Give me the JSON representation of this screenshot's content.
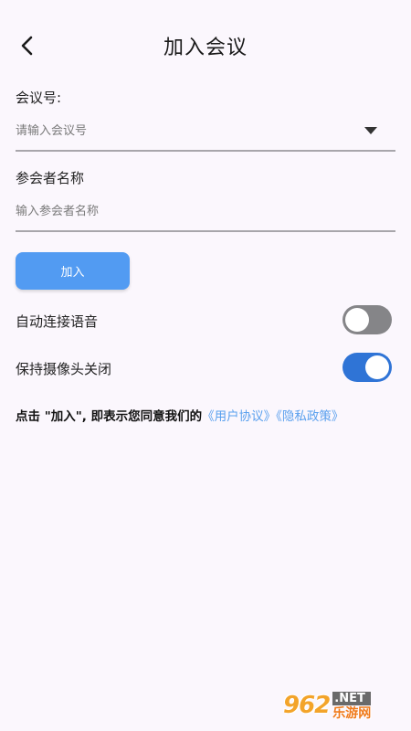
{
  "header": {
    "title": "加入会议",
    "back_icon": "chevron-left-icon"
  },
  "meeting_id": {
    "label": "会议号:",
    "value": "",
    "placeholder": "请输入会议号",
    "dropdown_icon": "caret-down-icon"
  },
  "participant": {
    "label": "参会者名称",
    "value": "",
    "placeholder": "输入参会者名称"
  },
  "join_button": {
    "label": "加入",
    "color": "#529bf2"
  },
  "settings": {
    "auto_audio": {
      "label": "自动连接语音",
      "enabled": false
    },
    "camera_off": {
      "label": "保持摄像头关闭",
      "enabled": true
    }
  },
  "agreement": {
    "prefix": "点击 \"加入\", 即表示您同意我们的",
    "user_agreement": "《用户协议》",
    "privacy_policy": "《隐私政策》",
    "link_color": "#5aa0ee"
  },
  "watermark": {
    "logo": "962",
    "net": ".NET",
    "site": "乐游网"
  }
}
